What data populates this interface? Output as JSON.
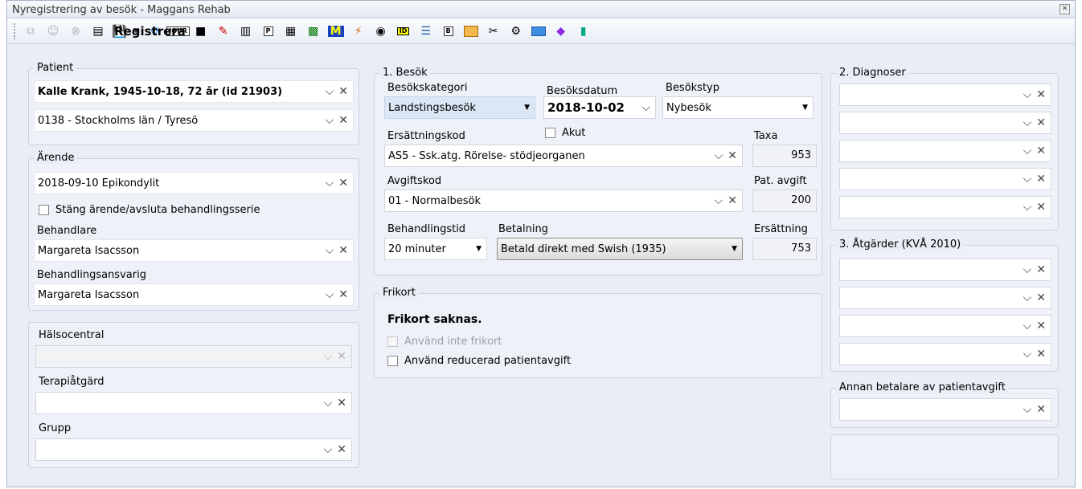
{
  "window": {
    "title": "Nyregistrering av besök  - Maggans Rehab"
  },
  "toolbar": {
    "register_label": "Registrera",
    "icons": [
      "copy-icon",
      "person-icon",
      "cancel-icon",
      "document-icon",
      "save-icon",
      "refresh-icon",
      "journal-icon",
      "briefcase-icon",
      "edit-note-icon",
      "visit-barcode-icon",
      "p-card-icon",
      "notes-icon",
      "calculator-icon",
      "m-icon",
      "flash-card-icon",
      "chat-icon",
      "id-icon",
      "list-icon",
      "b-icon",
      "grid-icon",
      "tool-icon",
      "people-icon",
      "payment-icon",
      "book-icon",
      "exit-icon"
    ]
  },
  "patient": {
    "section": "Patient",
    "name": "Kalle Krank, 1945-10-18, 72 år (id 21903)",
    "region": "0138 - Stockholms län / Tyresö"
  },
  "arende": {
    "section": "Ärende",
    "value": "2018-09-10 Epikondylit",
    "close_checkbox": "Stäng ärende/avsluta behandlingsserie",
    "behandlare_label": "Behandlare",
    "behandlare_value": "Margareta Isacsson",
    "ansvarig_label": "Behandlingsansvarig",
    "ansvarig_value": "Margareta Isacsson"
  },
  "lower_left": {
    "halsocentral_label": "Hälsocentral",
    "halsocentral_value": "",
    "terapi_label": "Terapiåtgärd",
    "terapi_value": "",
    "grupp_label": "Grupp",
    "grupp_value": ""
  },
  "besok": {
    "section": "1. Besök",
    "kategori_label": "Besökskategori",
    "kategori_value": "Landstingsbesök",
    "datum_label": "Besöksdatum",
    "datum_value": "2018-10-02",
    "typ_label": "Besökstyp",
    "typ_value": "Nybesök",
    "akut_label": "Akut",
    "ersattningskod_label": "Ersättningskod",
    "ersattningskod_value": "AS5 - Ssk.atg. Rörelse- stödjeorganen",
    "taxa_label": "Taxa",
    "taxa_value": "953",
    "avgiftskod_label": "Avgiftskod",
    "avgiftskod_value": "01 - Normalbesök",
    "patavgift_label": "Pat. avgift",
    "patavgift_value": "200",
    "behandlingstid_label": "Behandlingstid",
    "behandlingstid_value": "20 minuter",
    "betalning_label": "Betalning",
    "betalning_value": "Betald direkt med Swish (1935)",
    "ersattning_label": "Ersättning",
    "ersattning_value": "753"
  },
  "frikort": {
    "section": "Frikort",
    "status": "Frikort saknas.",
    "no_frikort": "Använd inte frikort",
    "reduced": "Använd reducerad patientavgift"
  },
  "diagnoser": {
    "section": "2. Diagnoser",
    "rows": [
      "",
      "",
      "",
      "",
      ""
    ]
  },
  "atgarder": {
    "section": "3. Åtgärder (KVÅ 2010)",
    "rows": [
      "",
      "",
      "",
      ""
    ]
  },
  "annan_betalare": {
    "label": "Annan betalare av patientavgift",
    "value": ""
  }
}
